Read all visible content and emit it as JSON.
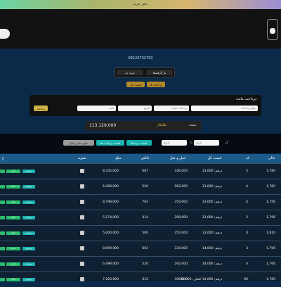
{
  "top_title": "دفتر خرید",
  "phone": "09120732753",
  "tabs": [
    {
      "label": "خرید بار"
    },
    {
      "label": "بار گرفته‌ها"
    }
  ],
  "actions": [
    {
      "label": "لیست کل"
    },
    {
      "label": "پرداخت ها"
    }
  ],
  "payment": {
    "title": "پرداخت مانده:",
    "fields": [
      {
        "placeholder": "مبلغ پرداخت"
      },
      {
        "placeholder": "پرداخت شده"
      },
      {
        "placeholder": "تاریخ"
      },
      {
        "placeholder": "بابت"
      }
    ],
    "button": "پرداخت"
  },
  "total": {
    "label": "نتیجه:",
    "status": "طلبکار",
    "value": "113,129,000"
  },
  "filters": {
    "from_label": "از",
    "to_label": "تا",
    "from_placeholder": "تاریخ",
    "to_placeholder": "تاریخ",
    "buttons": [
      "لیست خریدها",
      "لیست پرداخت ها",
      "جمع حمل و نقل"
    ]
  },
  "table": {
    "headers": [
      "خالی",
      "کد",
      "قیمت کل",
      "حمل و نقل",
      "خالص",
      "مبلغ",
      "تسویه",
      "ع"
    ],
    "rows": [
      {
        "col1": "1,780",
        "code": "5",
        "price": "درهم: 13,000",
        "transport": "336,000",
        "net": "667",
        "amount": "8,335,000"
      },
      {
        "col1": "1,760",
        "code": "4",
        "price": "درهم: 13,000",
        "transport": "262,000",
        "net": "520",
        "amount": "6,498,000"
      },
      {
        "col1": "1,756",
        "code": "4",
        "price": "درهم: 13,000",
        "transport": "354,000",
        "net": "704",
        "amount": "8,798,000"
      },
      {
        "col1": "1,796",
        "code": "2",
        "price": "درهم: 13,000",
        "transport": "208,000",
        "net": "414",
        "amount": "5,174,000"
      },
      {
        "col1": "1,810",
        "code": "0",
        "price": "درهم: 13,000",
        "transport": "250,000",
        "net": "500",
        "amount": "5,000,000"
      },
      {
        "col1": "1,796",
        "code": "3",
        "price": "درهم: 14,000",
        "transport": "334,000",
        "net": "663",
        "amount": "8,949,000"
      },
      {
        "col1": "1,766",
        "code": "4",
        "price": "درهم: 14,000",
        "transport": "262,000",
        "net": "520",
        "amount": "6,498,000"
      },
      {
        "col1": "1,760",
        "code": "66",
        "price": "درهم: 14,000 کشان: 15,000",
        "transport": "308,000",
        "net": "612",
        "amount": "7,220,000"
      }
    ]
  },
  "row_button_labels": {
    "edit": "ویرایش",
    "delete": "حذف"
  }
}
